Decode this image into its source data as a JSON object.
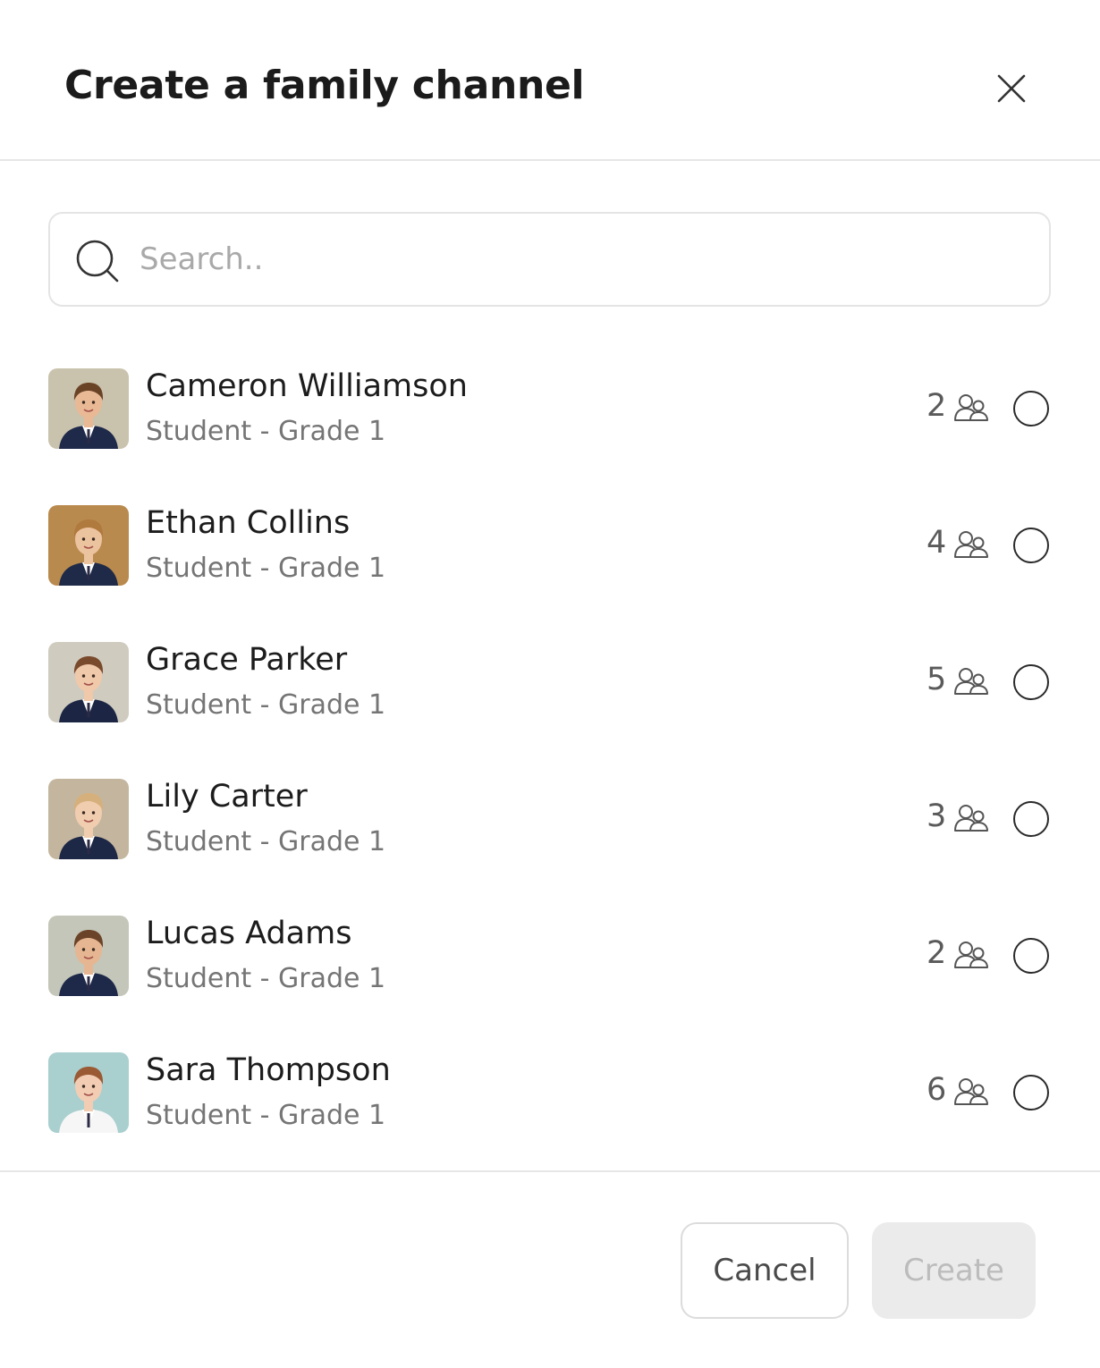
{
  "dialog": {
    "title": "Create a family channel"
  },
  "search": {
    "placeholder": "Search..",
    "value": ""
  },
  "students": [
    {
      "name": "Cameron Williamson",
      "role": "Student - Grade 1",
      "family_count": "2",
      "selected": false,
      "avatar": {
        "bg": "#c9c2ad",
        "hair": "#6a4326",
        "skin": "#e9b996",
        "uniform": "#1f2a4a"
      }
    },
    {
      "name": "Ethan Collins",
      "role": "Student - Grade 1",
      "family_count": "4",
      "selected": false,
      "avatar": {
        "bg": "#b98a4e",
        "hair": "#b07a3e",
        "skin": "#ecc39f",
        "uniform": "#1e2a48"
      }
    },
    {
      "name": "Grace Parker",
      "role": "Student - Grade 1",
      "family_count": "5",
      "selected": false,
      "avatar": {
        "bg": "#cfcbbf",
        "hair": "#7a4a2c",
        "skin": "#f0c8aa",
        "uniform": "#1c2644"
      }
    },
    {
      "name": "Lily Carter",
      "role": "Student - Grade 1",
      "family_count": "3",
      "selected": false,
      "avatar": {
        "bg": "#c4b69e",
        "hair": "#d6b07c",
        "skin": "#f1cdb0",
        "uniform": "#1d2746"
      }
    },
    {
      "name": "Lucas Adams",
      "role": "Student - Grade 1",
      "family_count": "2",
      "selected": false,
      "avatar": {
        "bg": "#c3c6b8",
        "hair": "#6b4328",
        "skin": "#e6b692",
        "uniform": "#1e2949"
      }
    },
    {
      "name": "Sara Thompson",
      "role": "Student - Grade 1",
      "family_count": "6",
      "selected": false,
      "avatar": {
        "bg": "#a9cfcf",
        "hair": "#9a5a34",
        "skin": "#f2cdb4",
        "uniform": "#f6f6f6"
      }
    }
  ],
  "footer": {
    "cancel_label": "Cancel",
    "create_label": "Create",
    "create_enabled": false
  },
  "icons": {
    "close": "close-icon",
    "search": "search-icon",
    "family": "family-members-icon",
    "radio": "radio-unchecked"
  }
}
